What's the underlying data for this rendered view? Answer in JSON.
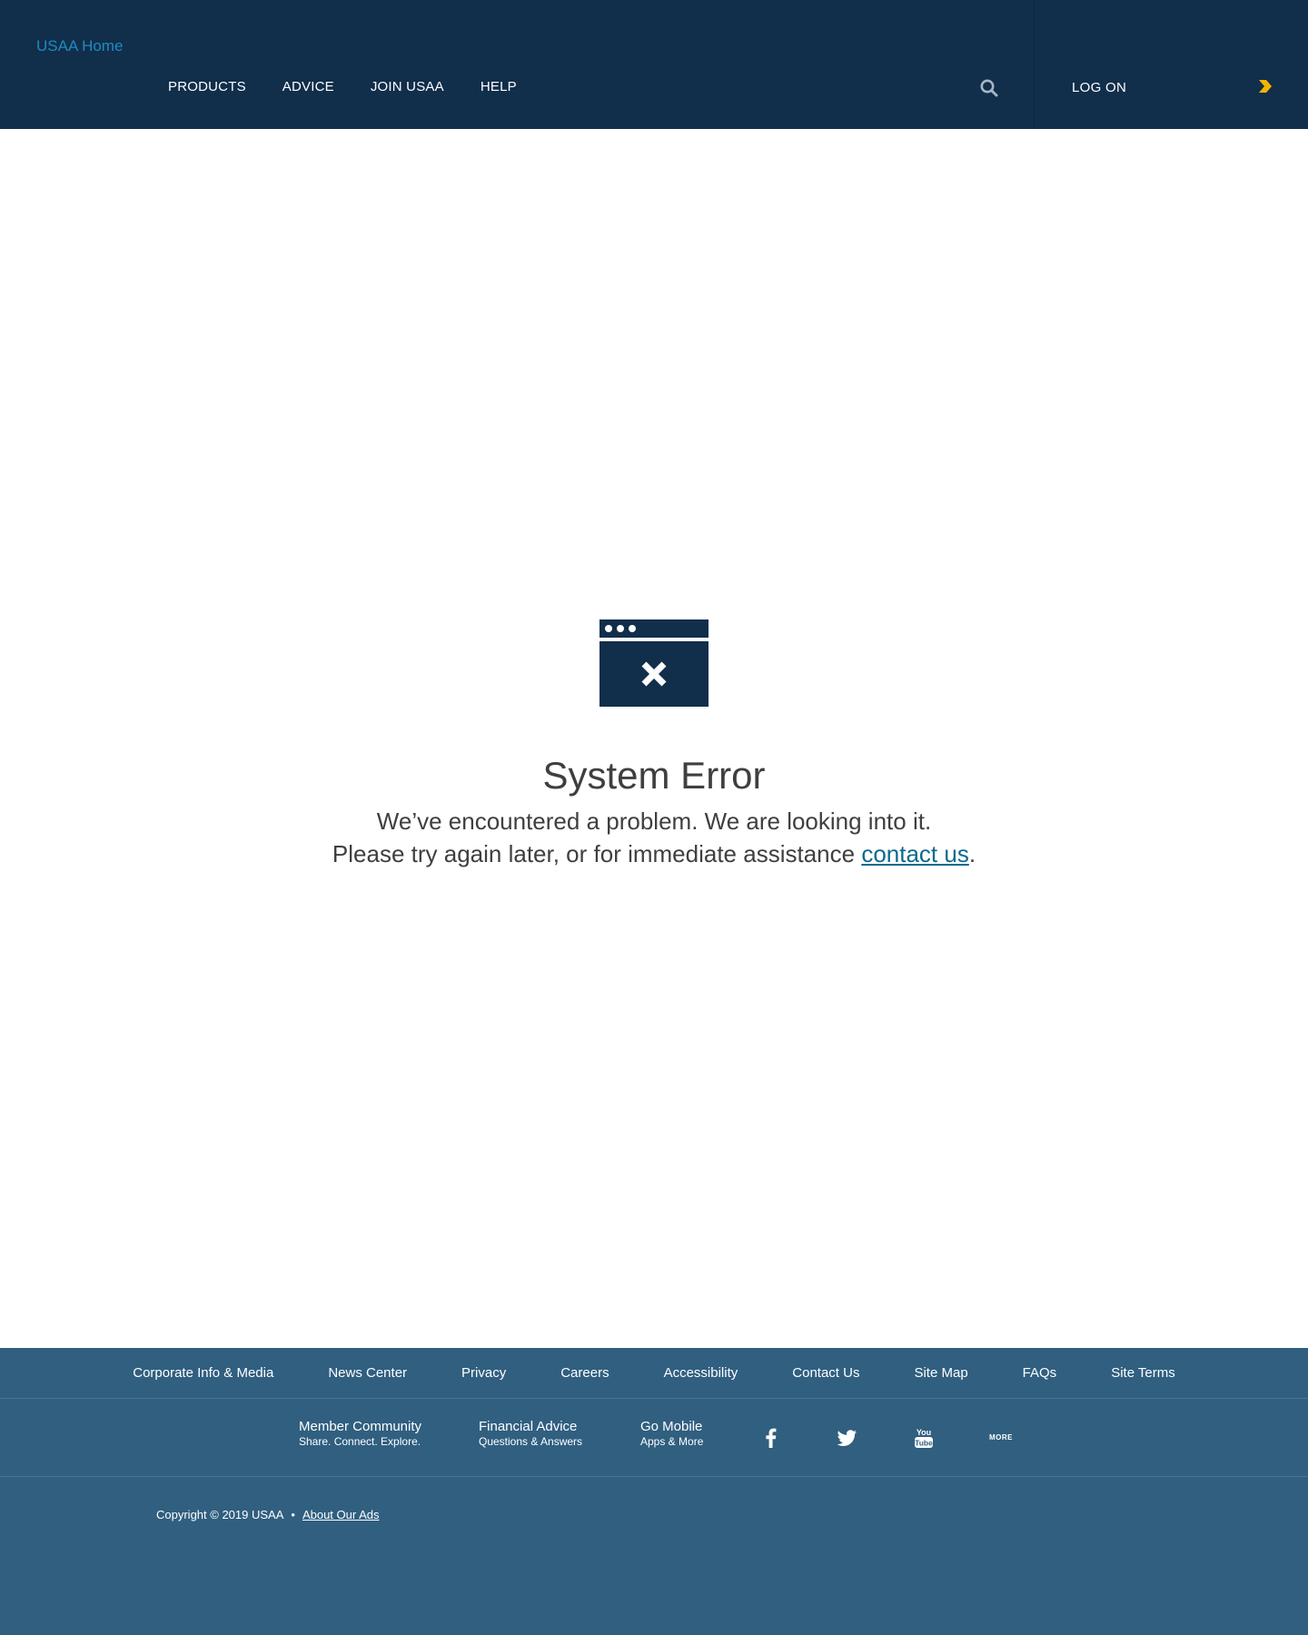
{
  "header": {
    "logo_alt": "USAA Home",
    "nav": [
      "PRODUCTS",
      "ADVICE",
      "JOIN USAA",
      "HELP"
    ],
    "logon_label": "LOG ON"
  },
  "main": {
    "title": "System Error",
    "message_line1": "We’ve encountered a problem. We are looking into it.",
    "message_line2_prefix": "Please try again later, or for immediate assistance ",
    "contact_link": "contact us",
    "message_line2_suffix": "."
  },
  "footer": {
    "links": [
      "Corporate Info & Media",
      "News Center",
      "Privacy",
      "Careers",
      "Accessibility",
      "Contact Us",
      "Site Map",
      "FAQs",
      "Site Terms"
    ],
    "promos": [
      {
        "title": "Member Community",
        "subtitle": "Share. Connect. Explore."
      },
      {
        "title": "Financial Advice",
        "subtitle": "Questions & Answers"
      },
      {
        "title": "Go Mobile",
        "subtitle": "Apps & More"
      }
    ],
    "social": [
      "facebook-icon",
      "twitter-icon",
      "youtube-icon",
      "more-icon"
    ],
    "more_label": "MORE",
    "copyright": "Copyright © 2019 USAA",
    "separator": "•",
    "about_ads": "About Our Ads"
  },
  "colors": {
    "header_bg": "#112e4b",
    "footer_bg": "#305f80",
    "link": "#0a6a8e",
    "accent_arrow": "#f2b400",
    "text": "#3f3f3f"
  }
}
